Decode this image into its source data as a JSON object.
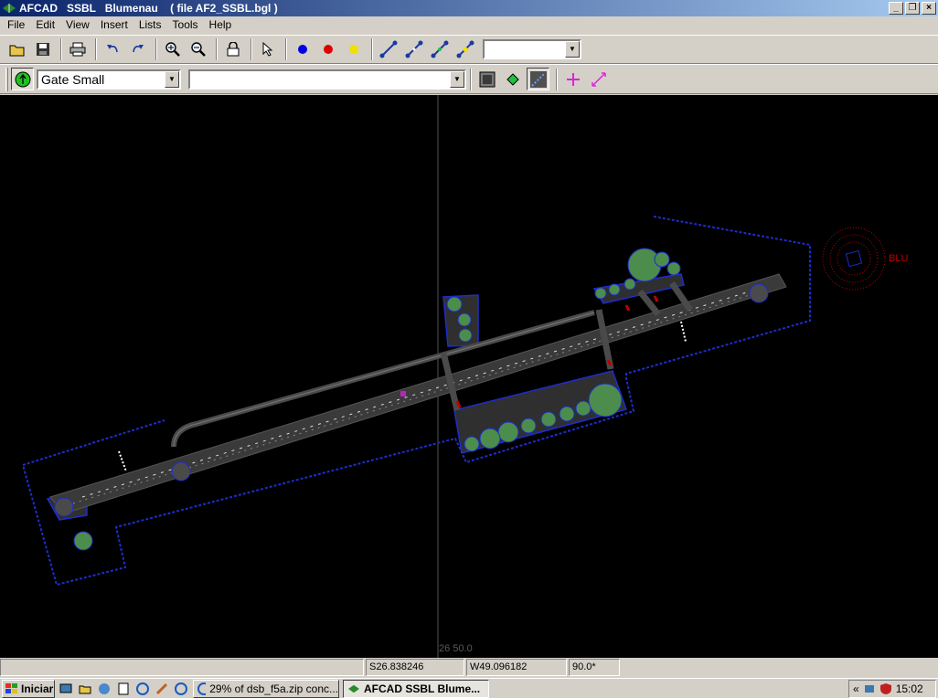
{
  "window": {
    "title": "AFCAD   SSBL   Blumenau    ( file AF2_SSBL.bgl )",
    "controls": [
      "minimize",
      "restore",
      "close"
    ]
  },
  "menu": [
    "File",
    "Edit",
    "View",
    "Insert",
    "Lists",
    "Tools",
    "Help"
  ],
  "toolbar1": {
    "buttons": [
      "open-icon",
      "save-icon",
      "print-icon",
      "undo-icon",
      "redo-icon",
      "zoom-in-icon",
      "zoom-out-icon",
      "lock-icon",
      "pointer-icon",
      "blue-node-icon",
      "red-node-icon",
      "yellow-node-icon",
      "path-blue-icon",
      "path-blue2-icon",
      "path-green-icon",
      "path-yellow-icon"
    ],
    "combo_value": ""
  },
  "toolbar2": {
    "parking_type": "Gate Small",
    "second_combo_value": "",
    "buttons": [
      "add-parking-icon",
      "boundary-icon",
      "node-icon",
      "edge-icon",
      "crosshair-icon",
      "link-icon"
    ]
  },
  "map": {
    "cursor_coord_label": "26 50.0",
    "ndb_ident": "BLU",
    "colors": {
      "background": "#000000",
      "boundary": "#1e2dcc",
      "pavement": "#3a3a3a",
      "trees": "#4c8c4c",
      "ndb": "#c00000"
    }
  },
  "status": {
    "pane1": "",
    "latitude": "S26.838246",
    "longitude": "W49.096182",
    "heading": "90.0*"
  },
  "taskbar": {
    "start_label": "Iniciar",
    "tasks": [
      {
        "label": "29% of dsb_f5a.zip conc...",
        "active": false
      },
      {
        "label": "AFCAD    SSBL    Blume...",
        "active": true
      }
    ],
    "tray_chevron": "«",
    "clock": "15:02"
  }
}
